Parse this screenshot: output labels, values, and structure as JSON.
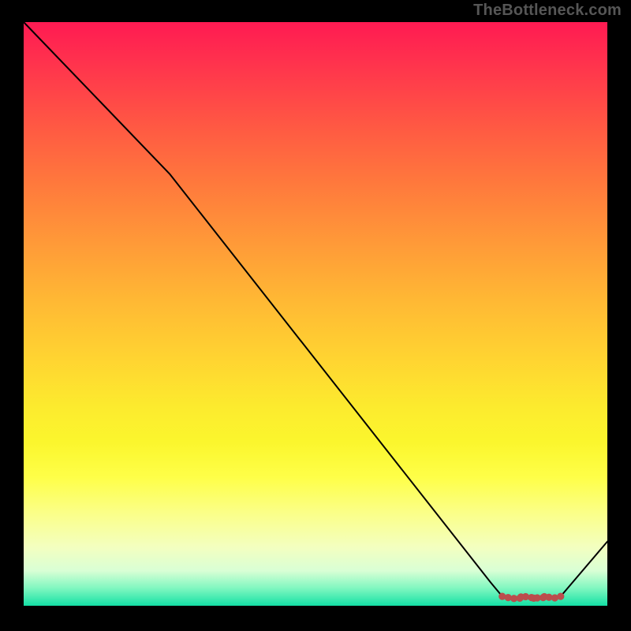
{
  "watermark": "TheBottleneck.com",
  "chart_data": {
    "type": "line",
    "title": "",
    "xlabel": "",
    "ylabel": "",
    "xlim": [
      0,
      100
    ],
    "ylim": [
      0,
      100
    ],
    "series": [
      {
        "name": "curve",
        "x": [
          0,
          25,
          80,
          82,
          84,
          85.2,
          85.4,
          86.0,
          87.4,
          87.6,
          88.2,
          89.2,
          89.4,
          90.2,
          91.0,
          92.0,
          100
        ],
        "values": [
          100,
          74,
          4,
          1.6,
          1.2,
          1.5,
          1.3,
          1.55,
          1.3,
          1.55,
          1.35,
          1.55,
          1.35,
          1.6,
          1.35,
          1.6,
          11
        ],
        "stroke": "#000000",
        "stroke_width": 2
      },
      {
        "name": "marker-dots",
        "x": [
          82.0,
          83.0,
          84.0,
          85.0,
          85.2,
          86.0,
          87.0,
          87.4,
          88.0,
          89.0,
          89.2,
          90.0,
          91.0,
          92.0
        ],
        "values": [
          1.6,
          1.4,
          1.25,
          1.3,
          1.5,
          1.55,
          1.4,
          1.3,
          1.35,
          1.4,
          1.55,
          1.45,
          1.35,
          1.6
        ],
        "stroke": "#bb4d4d",
        "marker_radius": 4.6
      }
    ],
    "gradient_stops": [
      {
        "pos": 0.0,
        "color": "#ff1a52"
      },
      {
        "pos": 0.18,
        "color": "#ff5943"
      },
      {
        "pos": 0.38,
        "color": "#ff9a38"
      },
      {
        "pos": 0.58,
        "color": "#ffd531"
      },
      {
        "pos": 0.78,
        "color": "#feff48"
      },
      {
        "pos": 0.94,
        "color": "#d9ffd5"
      },
      {
        "pos": 1.0,
        "color": "#14e0a5"
      }
    ]
  }
}
